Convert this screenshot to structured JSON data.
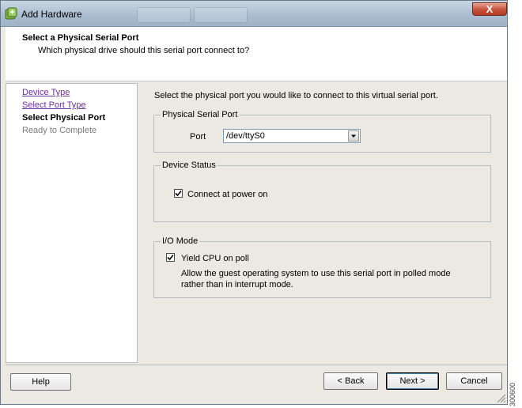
{
  "window": {
    "title": "Add Hardware",
    "close_label": "X"
  },
  "header": {
    "title": "Select a Physical Serial Port",
    "subtitle": "Which physical drive should this serial port connect to?"
  },
  "nav": {
    "items": [
      {
        "label": "Device Type",
        "state": "link"
      },
      {
        "label": "Select Port Type",
        "state": "link"
      },
      {
        "label": "Select Physical Port",
        "state": "current"
      },
      {
        "label": "Ready to Complete",
        "state": "future"
      }
    ]
  },
  "main": {
    "instruction": "Select the physical port you would like to connect to this virtual serial port.",
    "physical_port": {
      "legend": "Physical Serial Port",
      "port_label": "Port",
      "port_value": "/dev/ttyS0"
    },
    "device_status": {
      "legend": "Device Status",
      "connect_label": "Connect at power on",
      "connect_checked": true
    },
    "io_mode": {
      "legend": "I/O Mode",
      "yield_label": "Yield CPU on poll",
      "yield_checked": true,
      "description_line1": "Allow the guest operating system to use this serial port in polled mode",
      "description_line2": "rather than in interrupt mode."
    }
  },
  "footer": {
    "help_label": "Help",
    "back_label": "< Back",
    "next_label": "Next >",
    "cancel_label": "Cancel"
  },
  "figure_id": "300600",
  "colors": {
    "title_bar": "#a9bccf",
    "close_button": "#c7523c",
    "link": "#6b2fa0",
    "dialog_bg": "#ece9e3"
  }
}
